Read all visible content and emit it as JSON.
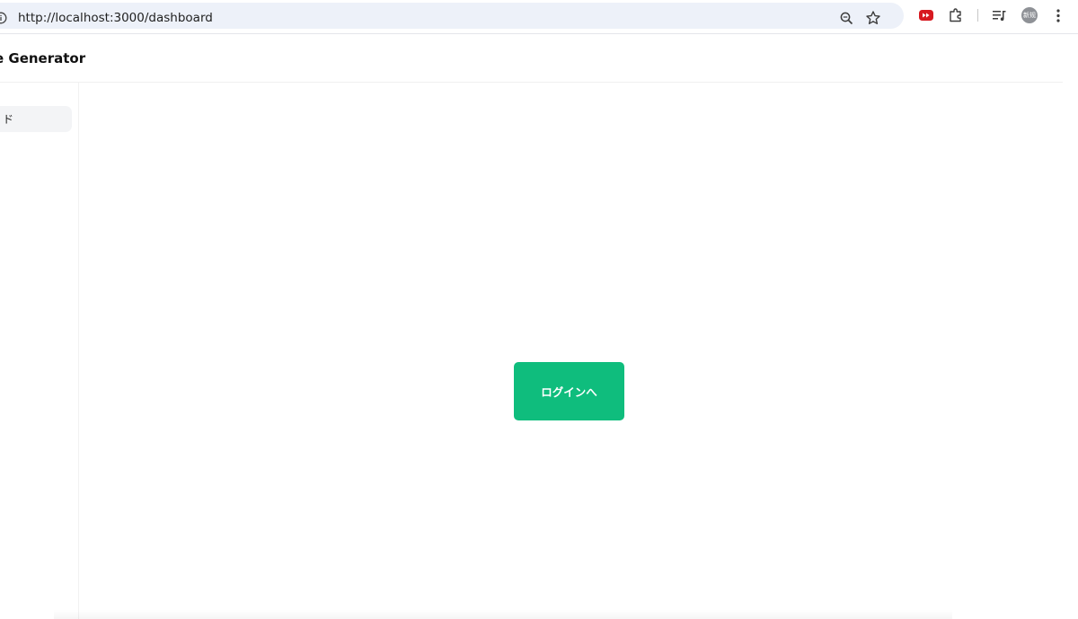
{
  "browser": {
    "url": "http://localhost:3000/dashboard",
    "profile_avatar_text": "新规"
  },
  "app": {
    "title": "e Generator"
  },
  "sidebar": {
    "items": [
      {
        "label": "ド",
        "active": true
      }
    ]
  },
  "main": {
    "login_button_label": "ログインへ"
  },
  "colors": {
    "accent": "#0fbd7d",
    "omnibox_bg": "#edf1f9",
    "sidebar_active_bg": "#f3f4f6"
  }
}
